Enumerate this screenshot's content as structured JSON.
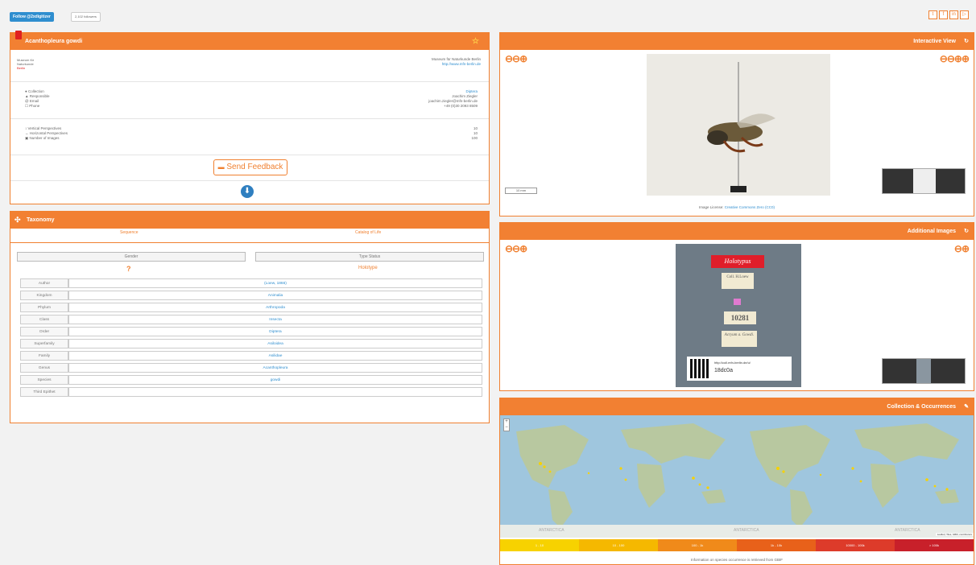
{
  "topbar": {
    "twitter_label": "Follow @2xdigitizer",
    "followers": "2,102 followers",
    "share_icons": [
      "twitter-icon",
      "facebook-icon",
      "linkedin-icon",
      "share-icon"
    ],
    "share_glyphs": [
      "t",
      "f",
      "in",
      "▷"
    ]
  },
  "specimen": {
    "title": "Acanthopleura gowdi",
    "institution_left": [
      "Museum für",
      "Naturkunde",
      "Berlin"
    ],
    "institution_right": "Museum für Naturkunde Berlin",
    "institution_url": "http://www.mfn-berlin.de",
    "info": [
      {
        "label": "Collection",
        "value": "Diptera"
      },
      {
        "label": "Responsible",
        "value": "Joachim Ziegler"
      },
      {
        "label": "Email",
        "value": "joachim.ziegler@mfn-berlin.de"
      },
      {
        "label": "Phone",
        "value": "+49 (0)30 2093 8509"
      }
    ],
    "stats": [
      {
        "label": "Vertical Perspectives",
        "value": "10"
      },
      {
        "label": "Horizontal Perspectives",
        "value": "10"
      },
      {
        "label": "Number of Images",
        "value": "100"
      }
    ],
    "feedback_label": "Send Feedback"
  },
  "taxonomy": {
    "title": "Taxonomy",
    "tabs": [
      "Sequence",
      "Catalog of Life"
    ],
    "buttons": [
      "Gender",
      "Type Status"
    ],
    "gender_value": "?",
    "type_status_value": "Holotype",
    "rows": [
      {
        "key": "Author",
        "value": "(Loew, 1866)"
      },
      {
        "key": "Kingdom",
        "value": "Animalia"
      },
      {
        "key": "Phylum",
        "value": "Arthropoda"
      },
      {
        "key": "Class",
        "value": "Insecta"
      },
      {
        "key": "Order",
        "value": "Diptera"
      },
      {
        "key": "Superfamily",
        "value": "Asiloidea"
      },
      {
        "key": "Family",
        "value": "Asilidae"
      },
      {
        "key": "Genus",
        "value": "Acanthopleura"
      },
      {
        "key": "Species",
        "value": "gowdi"
      },
      {
        "key": "Third Epithet",
        "value": ""
      }
    ]
  },
  "interactive_view": {
    "title": "Interactive View",
    "scale_label": "10 mm",
    "license_prefix": "Image License:",
    "license_link": "Creative Commons Zero (CC0)"
  },
  "additional_images": {
    "title": "Additional Images",
    "label_holotypus": "Holotypus",
    "label_coll": "Coll. H.Loew",
    "label_number": "10281",
    "label_name": "Acryum a. Gowdi.",
    "qr_url": "http://coll.mfn-berlin.de/u/",
    "qr_code": "18dc0a"
  },
  "map": {
    "title": "Collection & Occurrences",
    "zoom_in": "+",
    "zoom_out": "−",
    "antarctica": "ANTARCTICA",
    "attribution": "Leaflet | Tiles, GBIF, contributors",
    "legend": [
      {
        "label": "1 - 10",
        "color": "#f7d200"
      },
      {
        "label": "10 - 100",
        "color": "#f5b800"
      },
      {
        "label": "100 - 1k",
        "color": "#f08a1a"
      },
      {
        "label": "1k - 10k",
        "color": "#e8611a"
      },
      {
        "label": "10000 - 100k",
        "color": "#dd3b2a"
      },
      {
        "label": "> 100k",
        "color": "#c8202a"
      }
    ],
    "footer": "Information on species occurrence is retrieved from GBIF"
  }
}
